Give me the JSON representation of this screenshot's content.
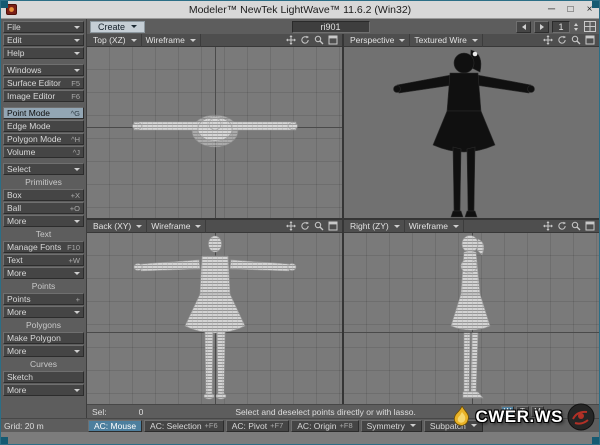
{
  "window": {
    "title": "Modeler™ NewTek LightWave™ 11.6.2 (Win32)",
    "controls": {
      "minimize": "─",
      "maximize": "□",
      "close": "×"
    }
  },
  "toolbar": {
    "tab": "Create",
    "object_name": "ri901",
    "layer": "1"
  },
  "sidebar": {
    "items": [
      {
        "type": "button",
        "label": "File",
        "arrow": true
      },
      {
        "type": "button",
        "label": "Edit",
        "arrow": true
      },
      {
        "type": "button",
        "label": "Help",
        "arrow": true
      },
      {
        "type": "gap"
      },
      {
        "type": "button",
        "label": "Windows",
        "arrow": true
      },
      {
        "type": "button",
        "label": "Surface Editor",
        "shortcut": "F5"
      },
      {
        "type": "button",
        "label": "Image Editor",
        "shortcut": "F6"
      },
      {
        "type": "gap"
      },
      {
        "type": "button",
        "label": "Point Mode",
        "shortcut": "^G",
        "selected": true
      },
      {
        "type": "button",
        "label": "Edge Mode"
      },
      {
        "type": "button",
        "label": "Polygon Mode",
        "shortcut": "^H"
      },
      {
        "type": "button",
        "label": "Volume",
        "shortcut": "^J"
      },
      {
        "type": "gap"
      },
      {
        "type": "button",
        "label": "Select",
        "arrow": true
      },
      {
        "type": "header",
        "label": "Primitives"
      },
      {
        "type": "button",
        "label": "Box",
        "shortcut": "+X"
      },
      {
        "type": "button",
        "label": "Ball",
        "shortcut": "+O"
      },
      {
        "type": "button",
        "label": "More",
        "arrow": true
      },
      {
        "type": "header",
        "label": "Text"
      },
      {
        "type": "button",
        "label": "Manage Fonts",
        "shortcut": "F10"
      },
      {
        "type": "button",
        "label": "Text",
        "shortcut": "+W"
      },
      {
        "type": "button",
        "label": "More",
        "arrow": true
      },
      {
        "type": "header",
        "label": "Points"
      },
      {
        "type": "button",
        "label": "Points",
        "shortcut": "+"
      },
      {
        "type": "button",
        "label": "More",
        "arrow": true
      },
      {
        "type": "header",
        "label": "Polygons"
      },
      {
        "type": "button",
        "label": "Make Polygon"
      },
      {
        "type": "button",
        "label": "More",
        "arrow": true
      },
      {
        "type": "header",
        "label": "Curves"
      },
      {
        "type": "button",
        "label": "Sketch"
      },
      {
        "type": "button",
        "label": "More",
        "arrow": true
      }
    ]
  },
  "viewports": [
    {
      "name": "Top  (XZ)",
      "mode": "Wireframe"
    },
    {
      "name": "Perspective",
      "mode": "Textured Wire"
    },
    {
      "name": "Back  (XY)",
      "mode": "Wireframe"
    },
    {
      "name": "Right  (ZY)",
      "mode": "Wireframe"
    }
  ],
  "selrow": {
    "sel_label": "Sel:",
    "sel_count": "0",
    "hint": "Select and deselect points directly or with lasso.",
    "vmap_buttons": [
      "W",
      "T",
      "M"
    ]
  },
  "bottom": {
    "grid_label": "Grid: 20 m",
    "items": [
      {
        "label": "AC: Mouse",
        "selected": true
      },
      {
        "label": "AC: Selection",
        "shortcut": "+F6"
      },
      {
        "label": "AC: Pivot",
        "shortcut": "+F7"
      },
      {
        "label": "AC: Origin",
        "shortcut": "+F8"
      },
      {
        "label": "Symmetry",
        "arrow": true
      },
      {
        "label": "Subpatch",
        "arrow": true
      }
    ]
  },
  "watermark": {
    "text": "CWER.WS"
  },
  "colors": {
    "selected_mode": "#93a6b4",
    "selected_ac": "#4d7f9e",
    "frame": "#2b6e86",
    "viewport_bg": "#7a7a7a"
  }
}
